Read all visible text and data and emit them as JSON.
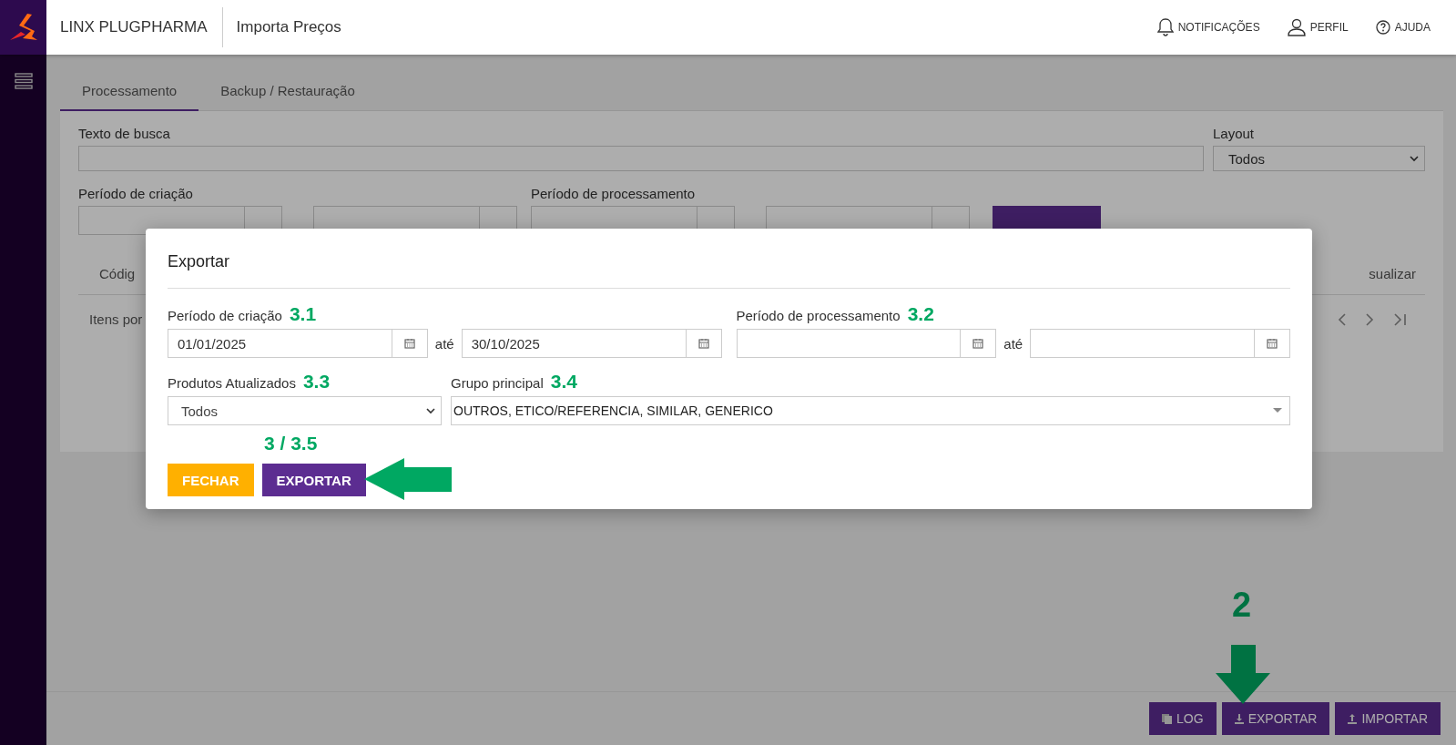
{
  "header": {
    "brand": "LINX PLUGPHARMA",
    "page_title": "Importa Preços",
    "actions": [
      {
        "kind": "bell",
        "label": "NOTIFICAÇÕES"
      },
      {
        "kind": "user",
        "label": "PERFIL"
      },
      {
        "kind": "help",
        "label": "AJUDA"
      }
    ]
  },
  "tabs": [
    {
      "label": "Processamento",
      "selected": true
    },
    {
      "label": "Backup / Restauração",
      "selected": false
    }
  ],
  "filters": {
    "search_label": "Texto de busca",
    "layout_label": "Layout",
    "layout_value": "Todos",
    "creation_label": "Período de criação",
    "processing_label": "Período de processamento"
  },
  "table": {
    "columns": [
      "Códig",
      "sualizar"
    ],
    "pager_label": "Itens por"
  },
  "footer_buttons": [
    {
      "kind": "log",
      "label": "LOG"
    },
    {
      "kind": "export",
      "label": "EXPORTAR"
    },
    {
      "kind": "import",
      "label": "IMPORTAR"
    }
  ],
  "modal": {
    "title": "Exportar",
    "fields": [
      {
        "kind": "daterange",
        "label": "Período de criação",
        "step": "3.1",
        "from": "01/01/2025",
        "separator": "até",
        "to": "30/10/2025"
      },
      {
        "kind": "daterange",
        "label": "Período de processamento",
        "step": "3.2",
        "separator": "até"
      },
      {
        "kind": "select",
        "label": "Produtos Atualizados",
        "step": "3.3",
        "value": "Todos"
      },
      {
        "kind": "multiselect",
        "label": "Grupo principal",
        "step": "3.4",
        "value": "OUTROS, ETICO/REFERENCIA, SIMILAR, GENERICO"
      }
    ],
    "buttons": [
      {
        "kind": "close",
        "label": "FECHAR"
      },
      {
        "kind": "primary",
        "label": "EXPORTAR"
      }
    ]
  },
  "annotations": [
    {
      "kind": "left-arrow",
      "label": "3 / 3.5"
    },
    {
      "kind": "down-arrow",
      "label": "2"
    }
  ]
}
